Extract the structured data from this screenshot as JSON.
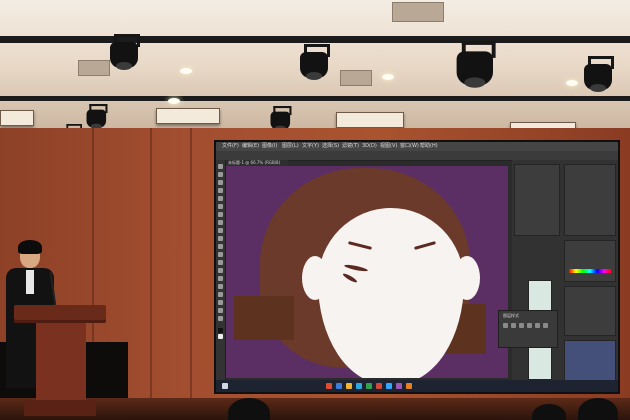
{
  "scene": {
    "description_label": "Presenter at podium in auditorium with projected Photoshop illustration",
    "colors": {
      "wall": "#a34e30",
      "canvas_bg": "#5b2f63",
      "hair": "#6b3a2a",
      "face": "#f6f3f1",
      "ps_ui": "#2b2b2b"
    }
  },
  "photoshop": {
    "menu": [
      "文件(F)",
      "编辑(E)",
      "图像(I)",
      "图层(L)",
      "文字(Y)",
      "选择(S)",
      "滤镜(T)",
      "3D(D)",
      "视图(V)",
      "窗口(W)",
      "帮助(H)"
    ],
    "document_tab": "未标题-1 @ 66.7% (RGB/8)",
    "float_panel_label": "图层样式"
  },
  "icons": {
    "tool_icons": "toolbar-tool-icon",
    "taskbar_icons": "taskbar-app-icon"
  }
}
